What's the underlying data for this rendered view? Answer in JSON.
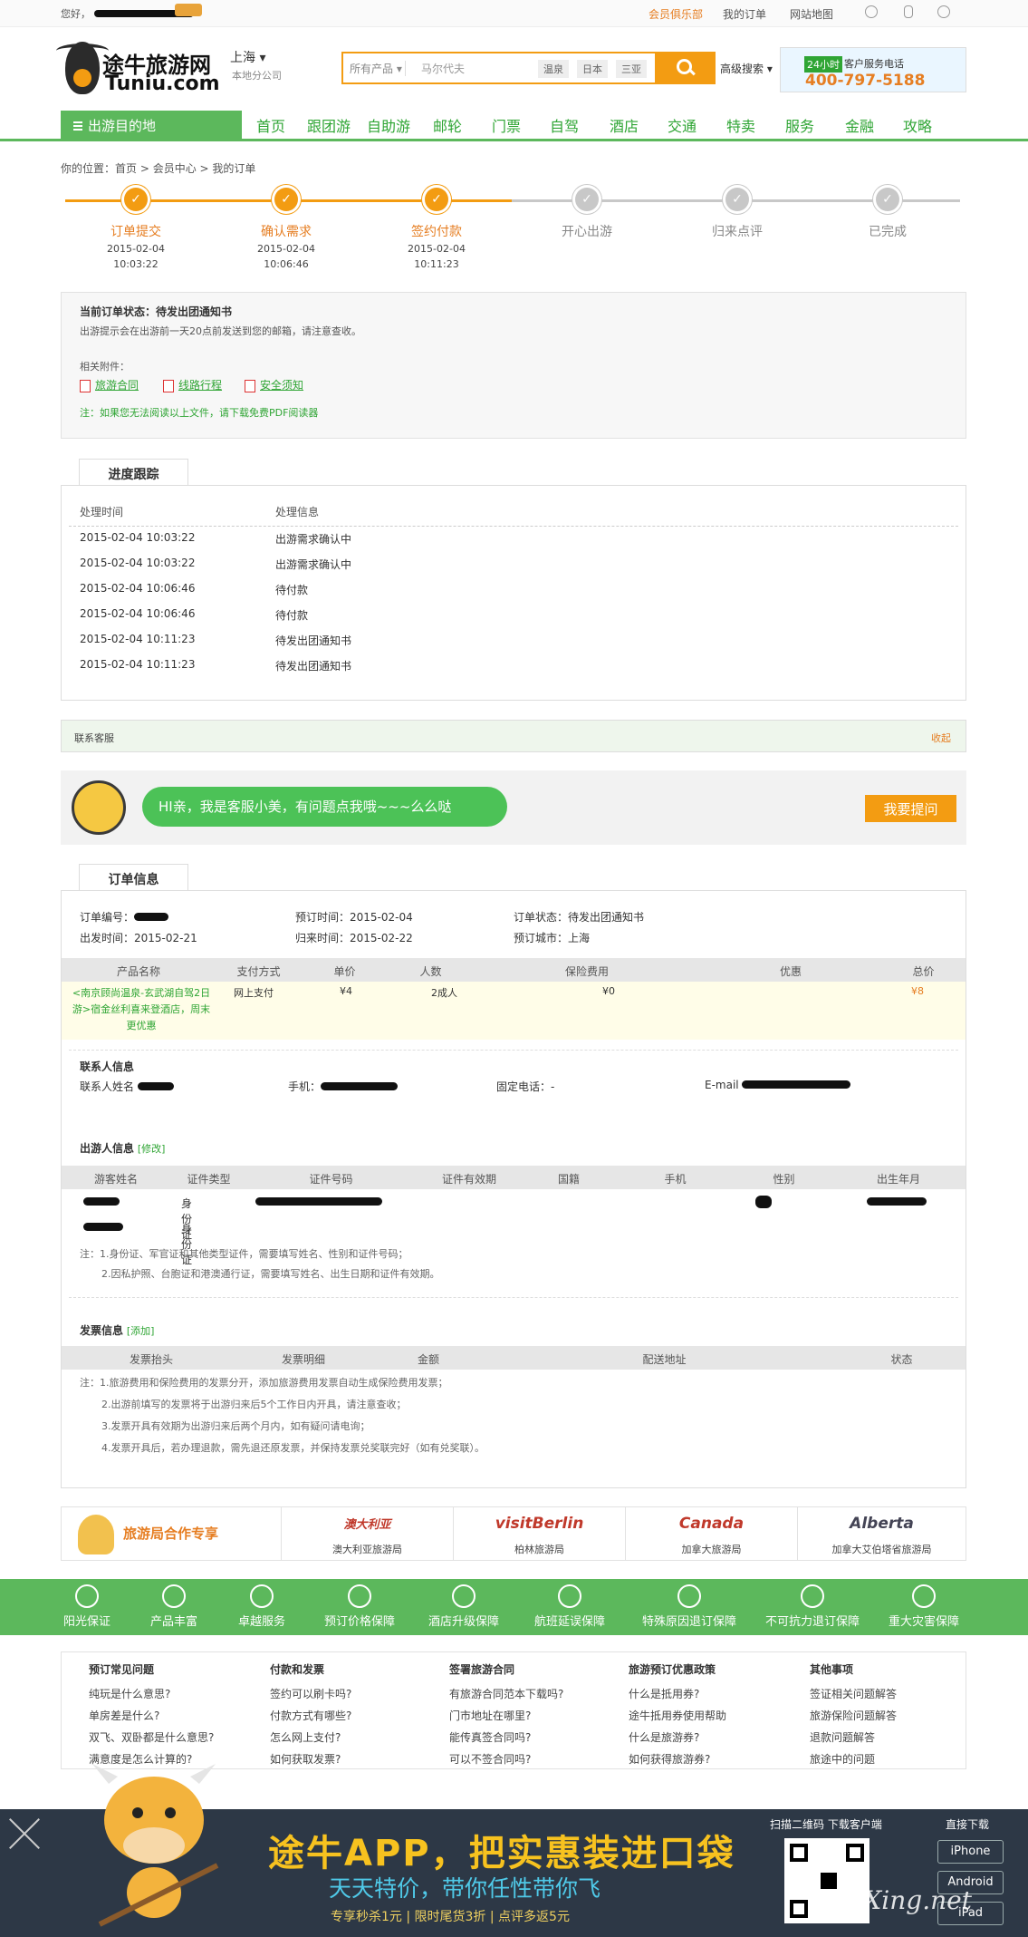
{
  "topbar": {
    "greeting": "您好，",
    "links": [
      "会员俱乐部",
      "我的订单",
      "网站地图"
    ]
  },
  "header": {
    "logo_cn": "途牛旅游网",
    "logo_en": "Tuniu.com",
    "city": "上海",
    "city_sub": "本地分公司",
    "search_category": "所有产品",
    "search_placeholder": "马尔代夫",
    "search_tags": [
      "温泉",
      "日本",
      "三亚"
    ],
    "advanced_search": "高级搜索",
    "hotline_badge": "24小时",
    "hotline_text": "客户服务电话",
    "hotline_number": "400-797-5188"
  },
  "nav": {
    "destination": "出游目的地",
    "items": [
      "首页",
      "跟团游",
      "自助游",
      "邮轮",
      "门票",
      "自驾",
      "酒店",
      "交通",
      "特卖",
      "服务",
      "金融",
      "攻略"
    ]
  },
  "breadcrumb": {
    "label": "你的位置：",
    "items": [
      "首页",
      "会员中心",
      "我的订单"
    ],
    "sep": " > "
  },
  "steps": [
    {
      "label": "订单提交",
      "date": "2015-02-04",
      "time": "10:03:22",
      "done": true
    },
    {
      "label": "确认需求",
      "date": "2015-02-04",
      "time": "10:06:46",
      "done": true
    },
    {
      "label": "签约付款",
      "date": "2015-02-04",
      "time": "10:11:23",
      "done": true
    },
    {
      "label": "开心出游",
      "date": "",
      "time": "",
      "done": false
    },
    {
      "label": "归来点评",
      "date": "",
      "time": "",
      "done": false
    },
    {
      "label": "已完成",
      "date": "",
      "time": "",
      "done": false
    }
  ],
  "status": {
    "title": "当前订单状态：待发出团通知书",
    "desc": "出游提示会在出游前一天20点前发送到您的邮箱，请注意查收。",
    "attach_label": "相关附件：",
    "attachments": [
      "旅游合同",
      "线路行程",
      "安全须知"
    ],
    "note": "注：如果您无法阅读以上文件，请下载免费PDF阅读器"
  },
  "progress": {
    "tab": "进度跟踪",
    "col_time": "处理时间",
    "col_info": "处理信息",
    "rows": [
      {
        "time": "2015-02-04 10:03:22",
        "info": "出游需求确认中"
      },
      {
        "time": "2015-02-04 10:03:22",
        "info": "出游需求确认中"
      },
      {
        "time": "2015-02-04 10:06:46",
        "info": "待付款"
      },
      {
        "time": "2015-02-04 10:06:46",
        "info": "待付款"
      },
      {
        "time": "2015-02-04 10:11:23",
        "info": "待发出团通知书"
      },
      {
        "time": "2015-02-04 10:11:23",
        "info": "待发出团通知书"
      }
    ]
  },
  "contact_service": {
    "label": "联系客服",
    "collapse": "收起"
  },
  "chat": {
    "bubble": "HI亲，我是客服小美，有问题点我哦~~~么么哒",
    "button": "我要提问"
  },
  "order": {
    "tab": "订单信息",
    "no_label": "订单编号：",
    "book_time_label": "预订时间：",
    "book_time": "2015-02-04",
    "status_label": "订单状态：",
    "status": "待发出团通知书",
    "depart_label": "出发时间：",
    "depart": "2015-02-21",
    "return_label": "归来时间：",
    "return": "2015-02-22",
    "city_label": "预订城市：",
    "city": "上海",
    "columns": [
      "产品名称",
      "支付方式",
      "单价",
      "人数",
      "保险费用",
      "优惠",
      "总价"
    ],
    "product_name": "<南京顾尚温泉-玄武湖自驾2日游>宿金丝利喜来登酒店，周末更优惠",
    "pay": "网上支付",
    "unit_price": "¥4",
    "people": "2成人",
    "insurance": "¥0",
    "discount": "",
    "total": "¥8"
  },
  "contact": {
    "title": "联系人信息",
    "name_label": "联系人姓名",
    "phone_label": "手机：",
    "tel_label": "固定电话：-",
    "email_label": "E-mail"
  },
  "travelers": {
    "title": "出游人信息",
    "edit": "[修改]",
    "columns": [
      "游客姓名",
      "证件类型",
      "证件号码",
      "证件有效期",
      "国籍",
      "手机",
      "性别",
      "出生年月"
    ],
    "id_type": "身份证",
    "notes": [
      "注：1.身份证、军官证和其他类型证件，需要填写姓名、性别和证件号码；",
      "2.因私护照、台胞证和港澳通行证，需要填写姓名、出生日期和证件有效期。"
    ]
  },
  "invoice": {
    "title": "发票信息",
    "add": "[添加]",
    "columns": [
      "发票抬头",
      "发票明细",
      "金额",
      "配送地址",
      "状态"
    ],
    "notes": [
      "注：1.旅游费用和保险费用的发票分开，添加旅游费用发票自动生成保险费用发票；",
      "2.出游前填写的发票将于出游归来后5个工作日内开具，请注意查收；",
      "3.发票开具有效期为出游归来后两个月内，如有疑问请电询；",
      "4.发票开具后，若办理退款，需先退还原发票，并保持发票兑奖联完好（如有兑奖联）。"
    ]
  },
  "tourism_banner": {
    "title": "旅游局合作专享",
    "partners": [
      {
        "logo": "澳大利亚",
        "name": "澳大利亚旅游局"
      },
      {
        "logo": "visitBerlin",
        "name": "柏林旅游局"
      },
      {
        "logo": "Canada",
        "name": "加拿大旅游局"
      },
      {
        "logo": "Alberta",
        "name": "加拿大艾伯塔省旅游局"
      }
    ]
  },
  "guarantees": [
    "阳光保证",
    "产品丰富",
    "卓越服务",
    "预订价格保障",
    "酒店升级保障",
    "航班延误保障",
    "特殊原因退订保障",
    "不可抗力退订保障",
    "重大灾害保障"
  ],
  "faq": [
    {
      "title": "预订常见问题",
      "items": [
        "纯玩是什么意思?",
        "单房差是什么?",
        "双飞、双卧都是什么意思?",
        "满意度是怎么计算的?"
      ]
    },
    {
      "title": "付款和发票",
      "items": [
        "签约可以刷卡吗?",
        "付款方式有哪些?",
        "怎么网上支付?",
        "如何获取发票?"
      ]
    },
    {
      "title": "签署旅游合同",
      "items": [
        "有旅游合同范本下载吗?",
        "门市地址在哪里?",
        "能传真签合同吗?",
        "可以不签合同吗?"
      ]
    },
    {
      "title": "旅游预订优惠政策",
      "items": [
        "什么是抵用券?",
        "途牛抵用券使用帮助",
        "什么是旅游券?",
        "如何获得旅游券?"
      ]
    },
    {
      "title": "其他事项",
      "items": [
        "签证相关问题解答",
        "旅游保险问题解答",
        "退款问题解答",
        "旅途中的问题"
      ]
    }
  ],
  "app": {
    "title": "途牛APP，把实惠装进口袋",
    "subtitle": "天天特价，带你任性带你飞",
    "promos": "专享秒杀1元  |  限时尾货3折  |  点评多返5元",
    "qr_text": "扫描二维码 下载客户端",
    "download": "直接下载",
    "buttons": [
      "iPhone",
      "Android",
      "iPad"
    ],
    "watermark": "Hu Xing.net"
  },
  "colors": {
    "green": "#5cb85c",
    "orange": "#f39c12",
    "grey_step": "#c8c8c8"
  }
}
